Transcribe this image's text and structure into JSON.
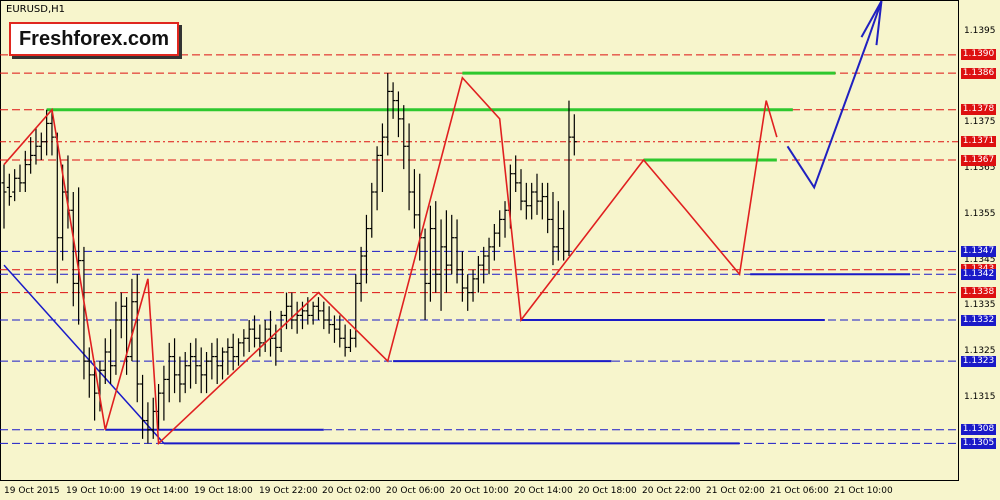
{
  "symbol_label": "EURUSD,H1",
  "watermark": "Freshforex.com",
  "chart_data": {
    "type": "candlestick",
    "title": "EURUSD,H1",
    "y_range": [
      1.1297,
      1.1402
    ],
    "y_ticks": [
      "1.1395",
      "1.1385",
      "1.1375",
      "1.1365",
      "1.1355",
      "1.1345",
      "1.1335",
      "1.1325",
      "1.1315"
    ],
    "x_ticks": [
      "19 Oct 2015",
      "19 Oct 10:00",
      "19 Oct 14:00",
      "19 Oct 18:00",
      "19 Oct 22:00",
      "20 Oct 02:00",
      "20 Oct 06:00",
      "20 Oct 10:00",
      "20 Oct 14:00",
      "20 Oct 18:00",
      "20 Oct 22:00",
      "21 Oct 02:00",
      "21 Oct 06:00",
      "21 Oct 10:00"
    ],
    "levels": [
      {
        "label": "1.1390",
        "value": 1.139,
        "color": "#dd1010",
        "style": "dashed"
      },
      {
        "label": "1.1386",
        "value": 1.1386,
        "color": "#dd1010",
        "style": "dashed"
      },
      {
        "label": "1.1378",
        "value": 1.1378,
        "color": "#dd1010",
        "style": "dashed"
      },
      {
        "label": "1.1371",
        "value": 1.1371,
        "color": "#dd1010",
        "style": "dashdot"
      },
      {
        "label": "1.1367",
        "value": 1.1367,
        "color": "#dd1010",
        "style": "dashed"
      },
      {
        "label": "1.1347",
        "value": 1.1347,
        "color": "#1a1ac8",
        "style": "dashed"
      },
      {
        "label": "1.1343",
        "value": 1.1343,
        "color": "#dd1010",
        "style": "dashed"
      },
      {
        "label": "1.1342",
        "value": 1.1342,
        "color": "#1a1ac8",
        "style": "dashed"
      },
      {
        "label": "1.1338",
        "value": 1.1338,
        "color": "#dd1010",
        "style": "dashed"
      },
      {
        "label": "1.1332",
        "value": 1.1332,
        "color": "#1a1ac8",
        "style": "dashed"
      },
      {
        "label": "1.1323",
        "value": 1.1323,
        "color": "#1a1ac8",
        "style": "dashed"
      },
      {
        "label": "1.1308",
        "value": 1.1308,
        "color": "#1a1ac8",
        "style": "dashed"
      },
      {
        "label": "1.1305",
        "value": 1.1305,
        "color": "#1a1ac8",
        "style": "dashed"
      }
    ],
    "bars": [
      {
        "o": 1.1362,
        "h": 1.1366,
        "l": 1.1352,
        "c": 1.136
      },
      {
        "o": 1.1361,
        "h": 1.1364,
        "l": 1.1357,
        "c": 1.1359
      },
      {
        "o": 1.136,
        "h": 1.1365,
        "l": 1.1358,
        "c": 1.1363
      },
      {
        "o": 1.1363,
        "h": 1.1366,
        "l": 1.136,
        "c": 1.1362
      },
      {
        "o": 1.1362,
        "h": 1.1369,
        "l": 1.136,
        "c": 1.1366
      },
      {
        "o": 1.1366,
        "h": 1.1372,
        "l": 1.1364,
        "c": 1.1368
      },
      {
        "o": 1.1368,
        "h": 1.1374,
        "l": 1.1366,
        "c": 1.137
      },
      {
        "o": 1.137,
        "h": 1.1373,
        "l": 1.1367,
        "c": 1.1371
      },
      {
        "o": 1.1371,
        "h": 1.1378,
        "l": 1.1368,
        "c": 1.1375
      },
      {
        "o": 1.1375,
        "h": 1.1378,
        "l": 1.1368,
        "c": 1.1372
      },
      {
        "o": 1.1372,
        "h": 1.1373,
        "l": 1.134,
        "c": 1.135
      },
      {
        "o": 1.135,
        "h": 1.1366,
        "l": 1.1345,
        "c": 1.136
      },
      {
        "o": 1.136,
        "h": 1.1368,
        "l": 1.1352,
        "c": 1.1356
      },
      {
        "o": 1.1356,
        "h": 1.136,
        "l": 1.1335,
        "c": 1.134
      },
      {
        "o": 1.134,
        "h": 1.1361,
        "l": 1.1331,
        "c": 1.1345
      },
      {
        "o": 1.1345,
        "h": 1.1348,
        "l": 1.1319,
        "c": 1.1323
      },
      {
        "o": 1.1323,
        "h": 1.1326,
        "l": 1.1315,
        "c": 1.132
      },
      {
        "o": 1.132,
        "h": 1.1323,
        "l": 1.131,
        "c": 1.1316
      },
      {
        "o": 1.1316,
        "h": 1.1323,
        "l": 1.1312,
        "c": 1.1321
      },
      {
        "o": 1.1321,
        "h": 1.1328,
        "l": 1.1318,
        "c": 1.1325
      },
      {
        "o": 1.1325,
        "h": 1.133,
        "l": 1.1318,
        "c": 1.1322
      },
      {
        "o": 1.1322,
        "h": 1.1336,
        "l": 1.132,
        "c": 1.1332
      },
      {
        "o": 1.1332,
        "h": 1.1338,
        "l": 1.1328,
        "c": 1.1335
      },
      {
        "o": 1.1335,
        "h": 1.1337,
        "l": 1.132,
        "c": 1.1324
      },
      {
        "o": 1.1324,
        "h": 1.1341,
        "l": 1.1323,
        "c": 1.1336
      },
      {
        "o": 1.1336,
        "h": 1.1342,
        "l": 1.1314,
        "c": 1.1318
      },
      {
        "o": 1.1318,
        "h": 1.132,
        "l": 1.1306,
        "c": 1.131
      },
      {
        "o": 1.131,
        "h": 1.1314,
        "l": 1.1305,
        "c": 1.1308
      },
      {
        "o": 1.1308,
        "h": 1.1315,
        "l": 1.1306,
        "c": 1.1312
      },
      {
        "o": 1.1312,
        "h": 1.1318,
        "l": 1.1308,
        "c": 1.1316
      },
      {
        "o": 1.1316,
        "h": 1.1322,
        "l": 1.131,
        "c": 1.1319
      },
      {
        "o": 1.1319,
        "h": 1.1327,
        "l": 1.1314,
        "c": 1.1324
      },
      {
        "o": 1.1324,
        "h": 1.1328,
        "l": 1.1316,
        "c": 1.132
      },
      {
        "o": 1.132,
        "h": 1.1324,
        "l": 1.1314,
        "c": 1.1318
      },
      {
        "o": 1.1318,
        "h": 1.1325,
        "l": 1.1316,
        "c": 1.1322
      },
      {
        "o": 1.1322,
        "h": 1.1327,
        "l": 1.1317,
        "c": 1.1324
      },
      {
        "o": 1.1324,
        "h": 1.1328,
        "l": 1.1318,
        "c": 1.1322
      },
      {
        "o": 1.1322,
        "h": 1.1326,
        "l": 1.1316,
        "c": 1.132
      },
      {
        "o": 1.132,
        "h": 1.1325,
        "l": 1.1316,
        "c": 1.1323
      },
      {
        "o": 1.1323,
        "h": 1.1327,
        "l": 1.1319,
        "c": 1.1324
      },
      {
        "o": 1.1324,
        "h": 1.1328,
        "l": 1.1318,
        "c": 1.1322
      },
      {
        "o": 1.1322,
        "h": 1.1326,
        "l": 1.1319,
        "c": 1.1325
      },
      {
        "o": 1.1325,
        "h": 1.1328,
        "l": 1.132,
        "c": 1.1326
      },
      {
        "o": 1.1326,
        "h": 1.1329,
        "l": 1.1321,
        "c": 1.1324
      },
      {
        "o": 1.1324,
        "h": 1.1328,
        "l": 1.1322,
        "c": 1.1327
      },
      {
        "o": 1.1327,
        "h": 1.133,
        "l": 1.1324,
        "c": 1.1328
      },
      {
        "o": 1.1328,
        "h": 1.1332,
        "l": 1.1325,
        "c": 1.133
      },
      {
        "o": 1.133,
        "h": 1.1333,
        "l": 1.1326,
        "c": 1.1328
      },
      {
        "o": 1.1328,
        "h": 1.1331,
        "l": 1.1324,
        "c": 1.1327
      },
      {
        "o": 1.1327,
        "h": 1.1332,
        "l": 1.1325,
        "c": 1.133
      },
      {
        "o": 1.133,
        "h": 1.1334,
        "l": 1.1324,
        "c": 1.1328
      },
      {
        "o": 1.1328,
        "h": 1.1331,
        "l": 1.1322,
        "c": 1.1326
      },
      {
        "o": 1.1326,
        "h": 1.1334,
        "l": 1.1325,
        "c": 1.1333
      },
      {
        "o": 1.1333,
        "h": 1.1338,
        "l": 1.133,
        "c": 1.1335
      },
      {
        "o": 1.1335,
        "h": 1.1338,
        "l": 1.133,
        "c": 1.1332
      },
      {
        "o": 1.1332,
        "h": 1.1336,
        "l": 1.1329,
        "c": 1.1333
      },
      {
        "o": 1.1333,
        "h": 1.1336,
        "l": 1.133,
        "c": 1.1334
      },
      {
        "o": 1.1334,
        "h": 1.1337,
        "l": 1.1331,
        "c": 1.1333
      },
      {
        "o": 1.1333,
        "h": 1.1336,
        "l": 1.1331,
        "c": 1.1335
      },
      {
        "o": 1.1335,
        "h": 1.1337,
        "l": 1.1332,
        "c": 1.1334
      },
      {
        "o": 1.1334,
        "h": 1.1336,
        "l": 1.133,
        "c": 1.1332
      },
      {
        "o": 1.1332,
        "h": 1.1335,
        "l": 1.1329,
        "c": 1.1331
      },
      {
        "o": 1.1331,
        "h": 1.1333,
        "l": 1.1327,
        "c": 1.133
      },
      {
        "o": 1.133,
        "h": 1.1333,
        "l": 1.1326,
        "c": 1.1328
      },
      {
        "o": 1.1328,
        "h": 1.1331,
        "l": 1.1324,
        "c": 1.1326
      },
      {
        "o": 1.1326,
        "h": 1.133,
        "l": 1.1325,
        "c": 1.1328
      },
      {
        "o": 1.1328,
        "h": 1.1342,
        "l": 1.1326,
        "c": 1.134
      },
      {
        "o": 1.134,
        "h": 1.1348,
        "l": 1.1336,
        "c": 1.1346
      },
      {
        "o": 1.1346,
        "h": 1.1355,
        "l": 1.134,
        "c": 1.1352
      },
      {
        "o": 1.1352,
        "h": 1.1362,
        "l": 1.135,
        "c": 1.136
      },
      {
        "o": 1.136,
        "h": 1.137,
        "l": 1.1356,
        "c": 1.1368
      },
      {
        "o": 1.1368,
        "h": 1.1375,
        "l": 1.136,
        "c": 1.1372
      },
      {
        "o": 1.1372,
        "h": 1.1386,
        "l": 1.1368,
        "c": 1.1382
      },
      {
        "o": 1.1382,
        "h": 1.1384,
        "l": 1.1376,
        "c": 1.138
      },
      {
        "o": 1.138,
        "h": 1.1382,
        "l": 1.1372,
        "c": 1.1376
      },
      {
        "o": 1.1376,
        "h": 1.1379,
        "l": 1.1365,
        "c": 1.137
      },
      {
        "o": 1.137,
        "h": 1.1375,
        "l": 1.1356,
        "c": 1.136
      },
      {
        "o": 1.136,
        "h": 1.1365,
        "l": 1.1352,
        "c": 1.1355
      },
      {
        "o": 1.1355,
        "h": 1.1364,
        "l": 1.1345,
        "c": 1.135
      },
      {
        "o": 1.135,
        "h": 1.1352,
        "l": 1.1332,
        "c": 1.134
      },
      {
        "o": 1.134,
        "h": 1.1357,
        "l": 1.1336,
        "c": 1.1352
      },
      {
        "o": 1.1352,
        "h": 1.1358,
        "l": 1.1338,
        "c": 1.1342
      },
      {
        "o": 1.1342,
        "h": 1.1354,
        "l": 1.1334,
        "c": 1.1348
      },
      {
        "o": 1.1348,
        "h": 1.1356,
        "l": 1.1338,
        "c": 1.1344
      },
      {
        "o": 1.1344,
        "h": 1.1355,
        "l": 1.1342,
        "c": 1.135
      },
      {
        "o": 1.135,
        "h": 1.1354,
        "l": 1.134,
        "c": 1.1343
      },
      {
        "o": 1.1343,
        "h": 1.1347,
        "l": 1.1336,
        "c": 1.1339
      },
      {
        "o": 1.1339,
        "h": 1.1342,
        "l": 1.1334,
        "c": 1.1338
      },
      {
        "o": 1.1338,
        "h": 1.1343,
        "l": 1.1336,
        "c": 1.1341
      },
      {
        "o": 1.1341,
        "h": 1.1346,
        "l": 1.1338,
        "c": 1.1344
      },
      {
        "o": 1.1344,
        "h": 1.1348,
        "l": 1.134,
        "c": 1.1346
      },
      {
        "o": 1.1346,
        "h": 1.135,
        "l": 1.1342,
        "c": 1.1348
      },
      {
        "o": 1.1348,
        "h": 1.1353,
        "l": 1.1345,
        "c": 1.1351
      },
      {
        "o": 1.1351,
        "h": 1.1356,
        "l": 1.1348,
        "c": 1.1354
      },
      {
        "o": 1.1354,
        "h": 1.1358,
        "l": 1.135,
        "c": 1.1356
      },
      {
        "o": 1.1356,
        "h": 1.1366,
        "l": 1.1352,
        "c": 1.1364
      },
      {
        "o": 1.1364,
        "h": 1.1368,
        "l": 1.136,
        "c": 1.1362
      },
      {
        "o": 1.1362,
        "h": 1.1365,
        "l": 1.1356,
        "c": 1.1358
      },
      {
        "o": 1.1358,
        "h": 1.1362,
        "l": 1.1354,
        "c": 1.1357
      },
      {
        "o": 1.1357,
        "h": 1.1362,
        "l": 1.1354,
        "c": 1.136
      },
      {
        "o": 1.136,
        "h": 1.1364,
        "l": 1.1355,
        "c": 1.1358
      },
      {
        "o": 1.1358,
        "h": 1.1362,
        "l": 1.1354,
        "c": 1.1359
      },
      {
        "o": 1.1359,
        "h": 1.1362,
        "l": 1.1351,
        "c": 1.1354
      },
      {
        "o": 1.1354,
        "h": 1.136,
        "l": 1.1344,
        "c": 1.1348
      },
      {
        "o": 1.1348,
        "h": 1.1358,
        "l": 1.1345,
        "c": 1.1352
      },
      {
        "o": 1.1352,
        "h": 1.1356,
        "l": 1.1345,
        "c": 1.1347
      },
      {
        "o": 1.1347,
        "h": 1.138,
        "l": 1.1346,
        "c": 1.1372
      },
      {
        "o": 1.1372,
        "h": 1.1377,
        "l": 1.1368,
        "c": 1.1371
      }
    ],
    "zigzag": [
      [
        0,
        1.1366
      ],
      [
        9,
        1.1378
      ],
      [
        19,
        1.1308
      ],
      [
        27,
        1.1341
      ],
      [
        29,
        1.1305
      ],
      [
        59,
        1.1338
      ],
      [
        72,
        1.1323
      ],
      [
        86,
        1.1385
      ],
      [
        93,
        1.1376
      ],
      [
        97,
        1.1332
      ],
      [
        120,
        1.1367
      ],
      [
        128,
        1.1356
      ],
      [
        138,
        1.1342
      ],
      [
        143,
        1.138
      ],
      [
        145,
        1.1372
      ]
    ],
    "support_lines": [
      {
        "value": 1.1378,
        "from": 8,
        "to": 148,
        "color": "#2ec82e"
      },
      {
        "value": 1.1386,
        "from": 86,
        "to": 156,
        "color": "#2ec82e"
      },
      {
        "value": 1.1367,
        "from": 120,
        "to": 145,
        "color": "#2ec82e"
      },
      {
        "value": 1.1308,
        "from": 19,
        "to": 60,
        "color": "#1a1ac8"
      },
      {
        "value": 1.1305,
        "from": 30,
        "to": 138,
        "color": "#1a1ac8"
      },
      {
        "value": 1.1323,
        "from": 73,
        "to": 114,
        "color": "#1a1ac8"
      },
      {
        "value": 1.1332,
        "from": 97,
        "to": 154,
        "color": "#1a1ac8"
      },
      {
        "value": 1.1342,
        "from": 140,
        "to": 170,
        "color": "#1a1ac8"
      }
    ],
    "trend_line": [
      [
        0,
        1.1344
      ],
      [
        30,
        1.1305
      ]
    ],
    "forecast_path": [
      [
        147,
        1.137
      ],
      [
        152,
        1.1361
      ],
      [
        162,
        1.1393
      ]
    ],
    "colors": {
      "background": "#f7f5cc",
      "bull": "#000000",
      "zigzag": "#e02020",
      "green": "#2ec82e",
      "blue": "#1a1ac8",
      "forecast": "#2020c0"
    }
  }
}
